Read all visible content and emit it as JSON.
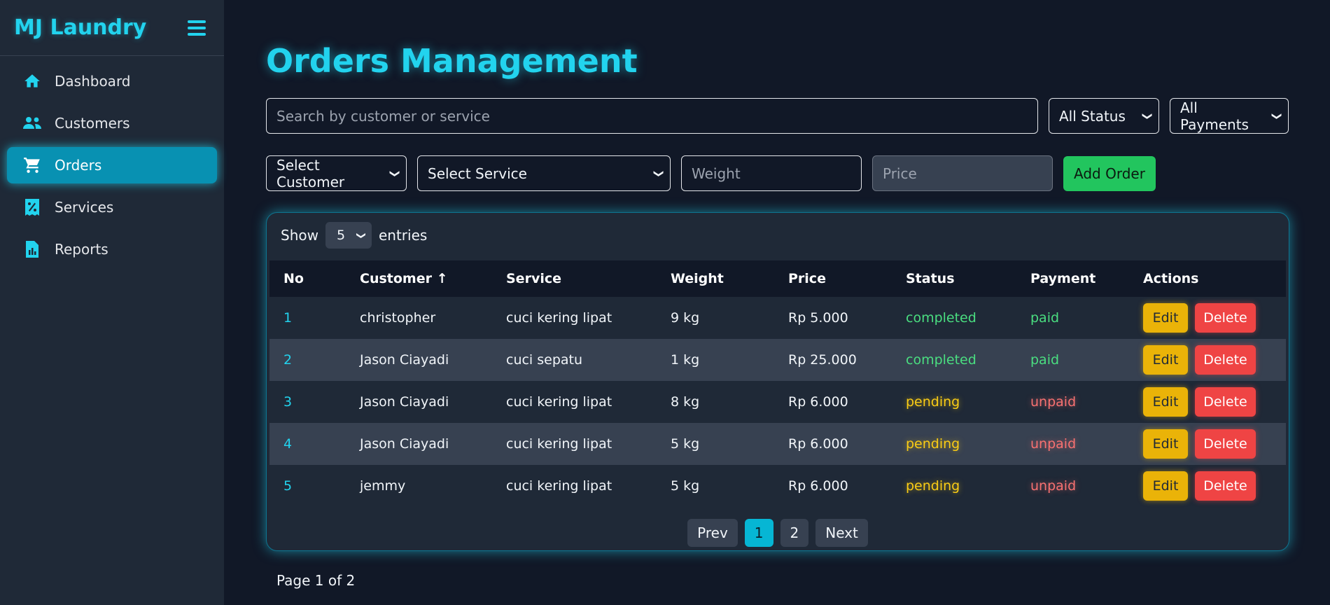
{
  "app": {
    "brand": "MJ Laundry"
  },
  "sidebar": {
    "items": [
      {
        "label": "Dashboard",
        "icon": "home-icon"
      },
      {
        "label": "Customers",
        "icon": "users-icon"
      },
      {
        "label": "Orders",
        "icon": "cart-icon",
        "active": true
      },
      {
        "label": "Services",
        "icon": "percent-receipt-icon"
      },
      {
        "label": "Reports",
        "icon": "report-chart-icon"
      }
    ]
  },
  "main": {
    "title": "Orders Management",
    "filters": {
      "search_placeholder": "Search by customer or service",
      "status_value": "All Status",
      "payment_value": "All Payments"
    },
    "form": {
      "customer_value": "Select Customer",
      "service_value": "Select Service",
      "weight_placeholder": "Weight",
      "price_placeholder": "Price",
      "add_label": "Add Order"
    },
    "table": {
      "show_label": "Show",
      "entries_value": "5",
      "entries_label": "entries",
      "headers": {
        "no": "No",
        "customer": "Customer ↑",
        "service": "Service",
        "weight": "Weight",
        "price": "Price",
        "status": "Status",
        "payment": "Payment",
        "actions": "Actions"
      },
      "edit_label": "Edit",
      "delete_label": "Delete",
      "rows": [
        {
          "no": "1",
          "customer": "christopher",
          "service": "cuci kering lipat",
          "weight": "9 kg",
          "price": "Rp 5.000",
          "status": "completed",
          "payment": "paid"
        },
        {
          "no": "2",
          "customer": "Jason Ciayadi",
          "service": "cuci sepatu",
          "weight": "1 kg",
          "price": "Rp 25.000",
          "status": "completed",
          "payment": "paid"
        },
        {
          "no": "3",
          "customer": "Jason Ciayadi",
          "service": "cuci kering lipat",
          "weight": "8 kg",
          "price": "Rp 6.000",
          "status": "pending",
          "payment": "unpaid"
        },
        {
          "no": "4",
          "customer": "Jason Ciayadi",
          "service": "cuci kering lipat",
          "weight": "5 kg",
          "price": "Rp 6.000",
          "status": "pending",
          "payment": "unpaid"
        },
        {
          "no": "5",
          "customer": "jemmy",
          "service": "cuci kering lipat",
          "weight": "5 kg",
          "price": "Rp 6.000",
          "status": "pending",
          "payment": "unpaid"
        }
      ]
    },
    "pagination": {
      "prev": "Prev",
      "pages": [
        "1",
        "2"
      ],
      "current": "1",
      "next": "Next",
      "info": "Page 1 of 2"
    }
  },
  "colors": {
    "accent": "#22d3ee",
    "active_nav": "#0891b2",
    "success": "#22c55e",
    "warning": "#eab308",
    "danger": "#ef4444",
    "background": "#111827",
    "panel": "#1f2937"
  }
}
